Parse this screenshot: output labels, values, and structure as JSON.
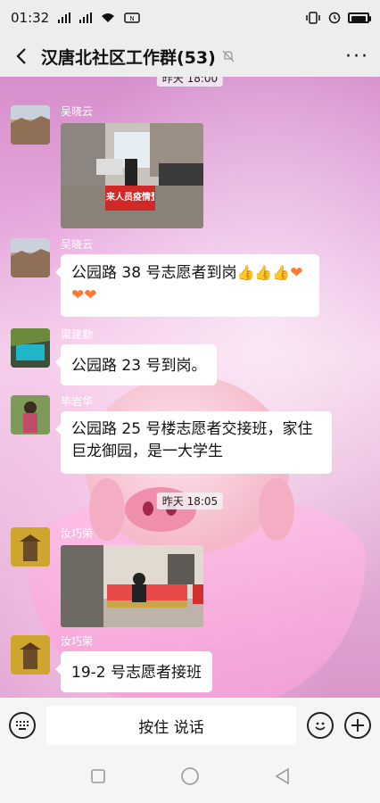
{
  "status_bar": {
    "time": "01:32",
    "left_icons": [
      "sim-signal-1-icon",
      "sim-signal-2-icon",
      "wifi-icon",
      "nfc-icon"
    ],
    "right_icons": [
      "vibrate-icon",
      "alarm-icon",
      "battery-icon"
    ]
  },
  "header": {
    "title": "汉唐北社区工作群(53)",
    "icons": [
      "back-icon",
      "mute-bell-icon",
      "more-options-icon"
    ]
  },
  "messages": [
    {
      "type": "time",
      "text": "昨天 18:00"
    },
    {
      "type": "image",
      "sender": "吴晓云",
      "image_caption": "来人员疫情登记"
    },
    {
      "type": "text",
      "sender": "吴晓云",
      "text_line1": "公园路 38 号志愿者到岗",
      "emoji": [
        "thumbs-up",
        "thumbs-up",
        "thumbs-up",
        "orange-heart",
        "orange-heart",
        "orange-heart"
      ]
    },
    {
      "type": "text",
      "sender": "梁建勤",
      "text": "公园路 23 号到岗。"
    },
    {
      "type": "text",
      "sender": "毕岩华",
      "text_line1": "公园路 25 号楼志愿者交接班，家住",
      "text_line2": "巨龙御园，是一大学生"
    },
    {
      "type": "time",
      "text": "昨天 18:05"
    },
    {
      "type": "image",
      "sender": "汝巧荣"
    },
    {
      "type": "text",
      "sender": "汝巧荣",
      "text": "19-2 号志愿者接班"
    }
  ],
  "input_bar": {
    "voice_button_label": "按住 说话",
    "icons": [
      "keyboard-icon",
      "emoji-icon",
      "plus-icon"
    ]
  },
  "nav_bar": {
    "icons": [
      "recent-apps-icon",
      "home-icon",
      "back-triangle-icon"
    ]
  }
}
